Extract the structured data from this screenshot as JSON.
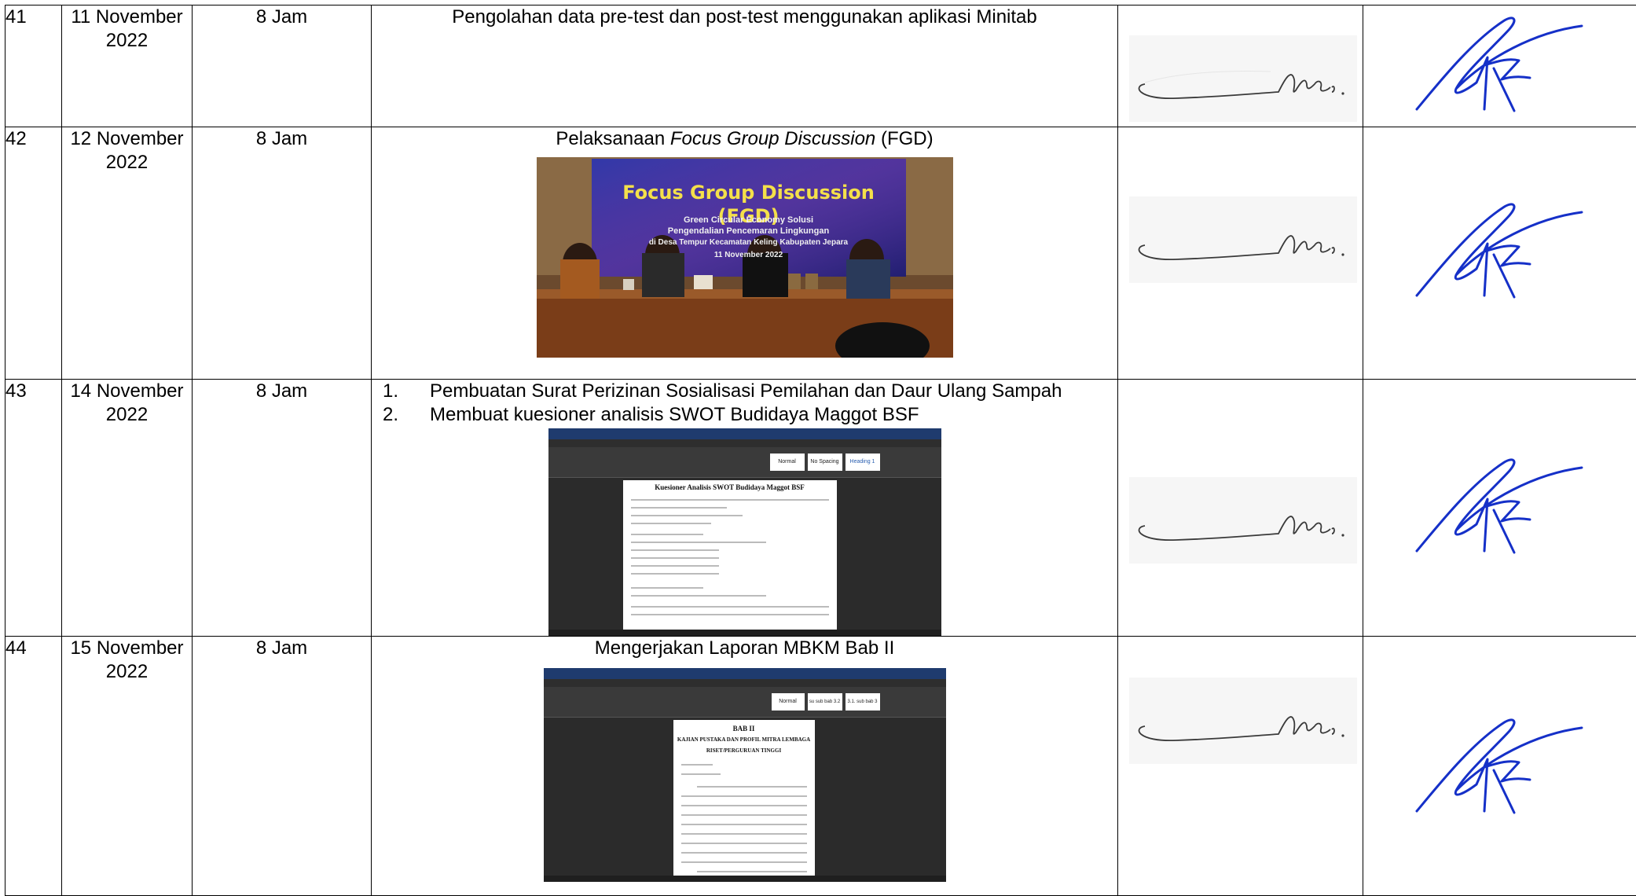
{
  "rows": [
    {
      "no": "41",
      "date": "11 November 2022",
      "duration": "8 Jam",
      "activity_title": "Pengolahan data pre-test dan post-test menggunakan aplikasi Minitab"
    },
    {
      "no": "42",
      "date": "12 November 2022",
      "duration": "8 Jam",
      "activity_title_prefix": "Pelaksanaan ",
      "activity_title_italic": "Focus Group Discussion",
      "activity_title_suffix": " (FGD)",
      "photo": {
        "banner_title": "Focus Group Discussion (FGD)",
        "banner_line1": "Green Circular Economy Solusi",
        "banner_line2": "Pengendalian Pencemaran Lingkungan",
        "banner_line3": "di Desa Tempur Kecamatan Keling Kabupaten Jepara",
        "banner_date": "11 November 2022"
      }
    },
    {
      "no": "43",
      "date": "14 November 2022",
      "duration": "8 Jam",
      "activity_items": [
        {
          "num": "1.",
          "text": "Pembuatan Surat Perizinan Sosialisasi Pemilahan dan Daur Ulang Sampah"
        },
        {
          "num": "2.",
          "text": "Membuat kuesioner analisis SWOT Budidaya Maggot BSF"
        }
      ],
      "screenshot": {
        "doc_heading": "Kuesioner Analisis SWOT Budidaya Maggot BSF",
        "style_normal": "Normal",
        "style_2": "No Spacing",
        "style_3": "Heading 1"
      }
    },
    {
      "no": "44",
      "date": "15 November 2022",
      "duration": "8 Jam",
      "activity_title": "Mengerjakan Laporan MBKM Bab II",
      "screenshot": {
        "doc_heading": "BAB II",
        "doc_sub1": "KAJIAN PUSTAKA DAN PROFIL MITRA LEMBAGA",
        "doc_sub2": "RISET/PERGURUAN TINGGI",
        "style_normal": "Normal",
        "style_2": "su sub bab 3.2",
        "style_3": "3.1. sub bab 3"
      }
    }
  ],
  "signature_colors": {
    "student": "#3a3a3a",
    "supervisor": "#1530c8"
  }
}
